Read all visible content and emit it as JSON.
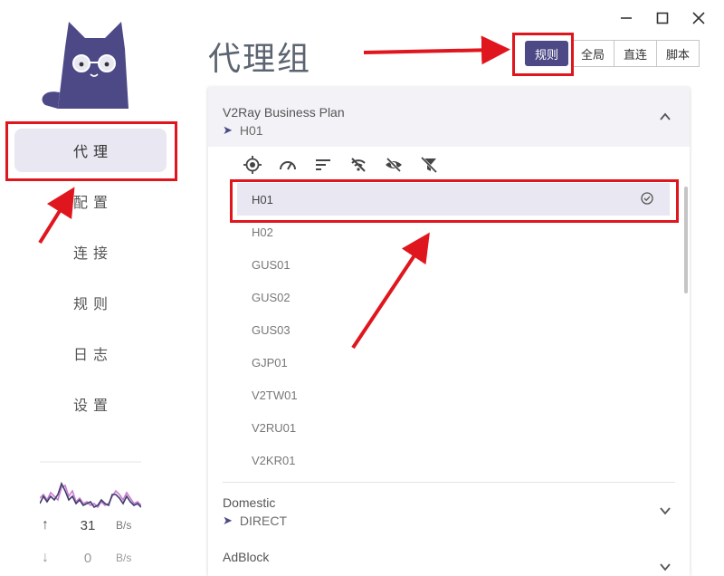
{
  "window": {
    "minimize": "—",
    "maximize": "☐",
    "close": "✕"
  },
  "sidebar": {
    "items": [
      {
        "label": "代理",
        "active": true
      },
      {
        "label": "配置",
        "active": false
      },
      {
        "label": "连接",
        "active": false
      },
      {
        "label": "规则",
        "active": false
      },
      {
        "label": "日志",
        "active": false
      },
      {
        "label": "设置",
        "active": false
      }
    ],
    "traffic": {
      "up_value": "31",
      "up_unit": "B/s",
      "down_value": "0",
      "down_unit": "B/s"
    }
  },
  "header": {
    "title": "代理组",
    "modes": [
      {
        "label": "规则",
        "active": true
      },
      {
        "label": "全局",
        "active": false
      },
      {
        "label": "直连",
        "active": false
      },
      {
        "label": "脚本",
        "active": false
      }
    ]
  },
  "groups": [
    {
      "name": "V2Ray Business Plan",
      "selected": "H01",
      "expanded": true,
      "tools": [
        "locate-icon",
        "speed-test-icon",
        "sort-icon",
        "hide-unavailable-icon",
        "hide-icon",
        "filter-off-icon"
      ],
      "proxies": [
        "H01",
        "H02",
        "GUS01",
        "GUS02",
        "GUS03",
        "GJP01",
        "V2TW01",
        "V2RU01",
        "V2KR01"
      ]
    },
    {
      "name": "Domestic",
      "selected": "DIRECT",
      "expanded": false
    },
    {
      "name": "AdBlock",
      "selected": "",
      "expanded": false
    }
  ],
  "colors": {
    "accent": "#4d4987",
    "active_bg": "#e8e7f2",
    "annotation": "#e0161e",
    "chart_up": "#3f3c6b",
    "chart_down": "#c77dd1"
  }
}
